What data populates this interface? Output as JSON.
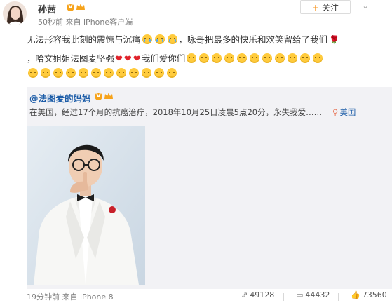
{
  "post": {
    "author": "孙茜",
    "time": "50秒前",
    "source_prefix": "来自",
    "source": "iPhone客户端",
    "follow_label": "关注",
    "line1_a": "无法形容我此刻的震惊与沉痛",
    "line1_b": "，咏哥把最多的快乐和欢笑留给了我们",
    "line2_a": "，哈文姐姐法图麦坚强",
    "line2_b": "我们爱你们"
  },
  "repost": {
    "author": "@法图麦的妈妈",
    "text": "在美国，经过17个月的抗癌治疗，2018年10月25日凌晨5点20分，永失我爱……",
    "location": "美国"
  },
  "footer": {
    "time": "19分钟前",
    "source_prefix": "来自",
    "source": "iPhone 8",
    "reposts": "49128",
    "comments": "44432",
    "likes": "73560"
  },
  "colors": {
    "link": "#1d5da8",
    "repost_bg": "#f2f2f5",
    "verified": "#f6a31b",
    "follow_plus": "#f7931e"
  },
  "icons": [
    "verified-badge-icon",
    "emoji-cry-icon",
    "emoji-yellow-face-icon",
    "heart-icon",
    "rose-icon",
    "location-pin-icon",
    "repost-icon",
    "comment-icon",
    "like-icon",
    "chevron-down-icon"
  ]
}
